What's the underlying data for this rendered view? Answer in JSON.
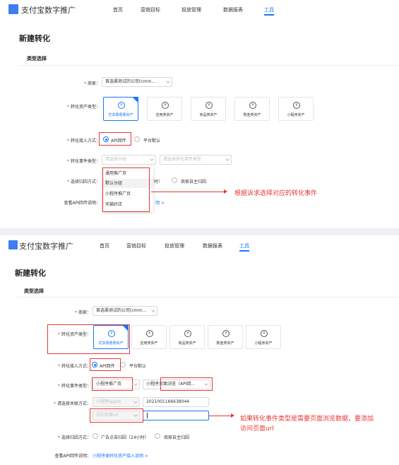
{
  "header": {
    "brand": "支付宝数字推广",
    "nav": [
      "首页",
      "营销目标",
      "投放管理",
      "数据报表",
      "工具"
    ],
    "active_nav": "工具",
    "accent_color": "#1677ff",
    "logo_color": "#3f7ef0"
  },
  "page": {
    "title": "新建转化",
    "section": "类型选择"
  },
  "form": {
    "merchant_label": "商家：",
    "merchant_value_1": "首选渠测试的公司(cmm...",
    "merchant_value_2": "首选渠测试的公司(cmm...",
    "asset_type_label": "转化资产类型：",
    "asset_cards": [
      "优享惠惠惠资产",
      "应用类资产",
      "商品类资产",
      "数金类资产",
      "小程序资产"
    ],
    "access_label": "转化接入方式：",
    "access_options": [
      "API回传",
      "平台默认"
    ],
    "event_type_label": "转化事件类型：",
    "event_select_placeholder": "请选择分组",
    "event_type_placeholder": "请选择转化事件类型",
    "event_select_value": "小程序推广页",
    "event_type_value": "小程序页面浏览（API回...",
    "attribution_label": "选择归因方式：",
    "attribution_options_1": [
      "时）",
      "商家自主归因"
    ],
    "attribution_options_2": [
      "广告点击归因（24小时）",
      "商家自主归因"
    ],
    "api_doc_label": "查看API回传说明：",
    "api_doc_link_1": "明 >",
    "api_doc_link_2": "小程序类转化资产接入说明 >",
    "relate_label": "请选择关联方式：",
    "relate_select": "小程序appid",
    "relate_input": "2021001166638044",
    "page_url_select": "访问页面url"
  },
  "dropdown": {
    "items": [
      "通用推广页",
      "默认分组",
      "小程序推广页",
      "天猫好店"
    ],
    "hover_index": 1
  },
  "annotations": {
    "note_1": "根据诉求选择对应的转化事件",
    "note_2_line1": "如果转化事件类型是需要页面浏览数据，要添加",
    "note_2_line2": "访问页面url",
    "color": "#e53935"
  }
}
